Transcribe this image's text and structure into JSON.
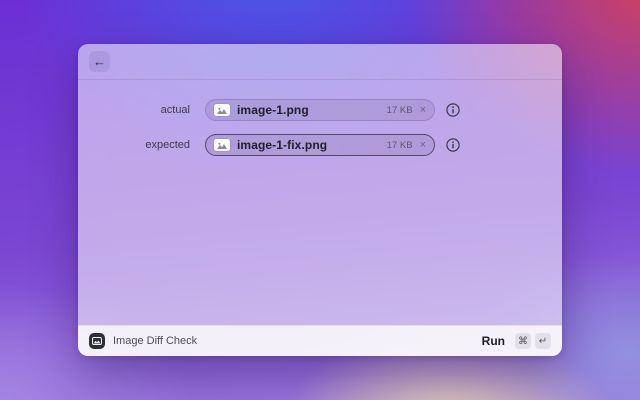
{
  "window": {
    "header": {
      "back_glyph": "←"
    },
    "fields": [
      {
        "label": "actual",
        "file": {
          "name": "image-1.png",
          "size": "17 KB",
          "remove_glyph": "×"
        }
      },
      {
        "label": "expected",
        "file": {
          "name": "image-1-fix.png",
          "size": "17 KB",
          "remove_glyph": "×"
        }
      }
    ],
    "footer": {
      "title": "Image Diff Check",
      "run_label": "Run",
      "shortcut_keys": {
        "cmd": "⌘",
        "return": "↵"
      }
    }
  },
  "colors": {
    "bg_purple": "#6b2fd4",
    "bg_blue": "#4757e9",
    "bg_red": "#d4425a",
    "bg_glow": "#eedbac",
    "window_tint": "rgba(255,255,255,0.54)"
  }
}
